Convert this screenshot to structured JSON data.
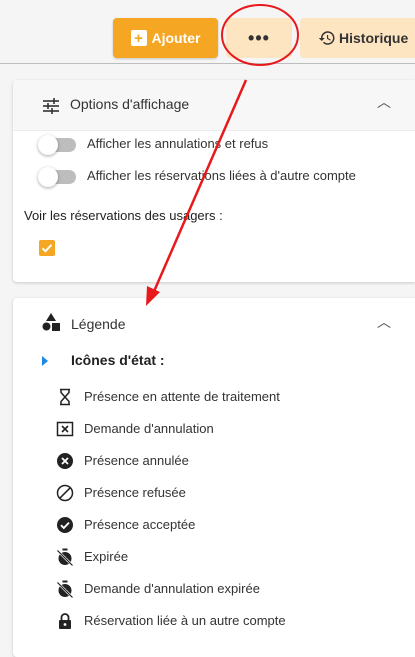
{
  "toolbar": {
    "add_label": "Ajouter",
    "more_label": "•••",
    "history_label": "Historique"
  },
  "display_options": {
    "title": "Options d'affichage",
    "toggles": [
      {
        "label": "Afficher les annulations et refus",
        "on": false
      },
      {
        "label": "Afficher les réservations liées à d'autre compte",
        "on": false
      }
    ],
    "users_label": "Voir les réservations des usagers :",
    "users_checked": true
  },
  "legend": {
    "title": "Légende",
    "subtitle": "Icônes d'état :",
    "items": [
      {
        "icon": "hourglass-icon",
        "label": "Présence en attente de traitement"
      },
      {
        "icon": "x-box-icon",
        "label": "Demande d'annulation"
      },
      {
        "icon": "x-circle-filled-icon",
        "label": "Présence annulée"
      },
      {
        "icon": "ban-circle-icon",
        "label": "Présence refusée"
      },
      {
        "icon": "check-circle-filled-icon",
        "label": "Présence acceptée"
      },
      {
        "icon": "timer-off-icon",
        "label": "Expirée"
      },
      {
        "icon": "timer-off-icon",
        "label": "Demande d'annulation expirée"
      },
      {
        "icon": "lock-icon",
        "label": "Réservation liée à un autre compte"
      }
    ]
  },
  "colors": {
    "accent": "#f5a623",
    "secondary": "#fde5c2",
    "annotation": "#e8191c",
    "caret": "#1e88e5"
  }
}
